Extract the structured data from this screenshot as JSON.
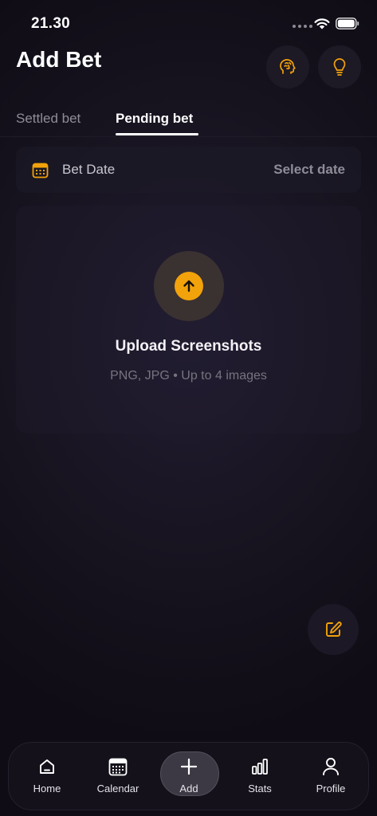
{
  "status_bar": {
    "time": "21.30"
  },
  "header": {
    "title": "Add Bet"
  },
  "tabs": [
    {
      "label": "Settled bet",
      "active": false
    },
    {
      "label": "Pending bet",
      "active": true
    }
  ],
  "date_row": {
    "label": "Bet Date",
    "value": "Select date"
  },
  "upload": {
    "title": "Upload Screenshots",
    "subtitle": "PNG, JPG • Up to 4 images"
  },
  "nav": [
    {
      "label": "Home",
      "icon": "home-icon"
    },
    {
      "label": "Calendar",
      "icon": "calendar-icon"
    },
    {
      "label": "Add",
      "icon": "plus-icon"
    },
    {
      "label": "Stats",
      "icon": "bar-chart-icon"
    },
    {
      "label": "Profile",
      "icon": "user-icon"
    }
  ],
  "colors": {
    "accent": "#f2a20a",
    "background": "#0f0c15"
  }
}
